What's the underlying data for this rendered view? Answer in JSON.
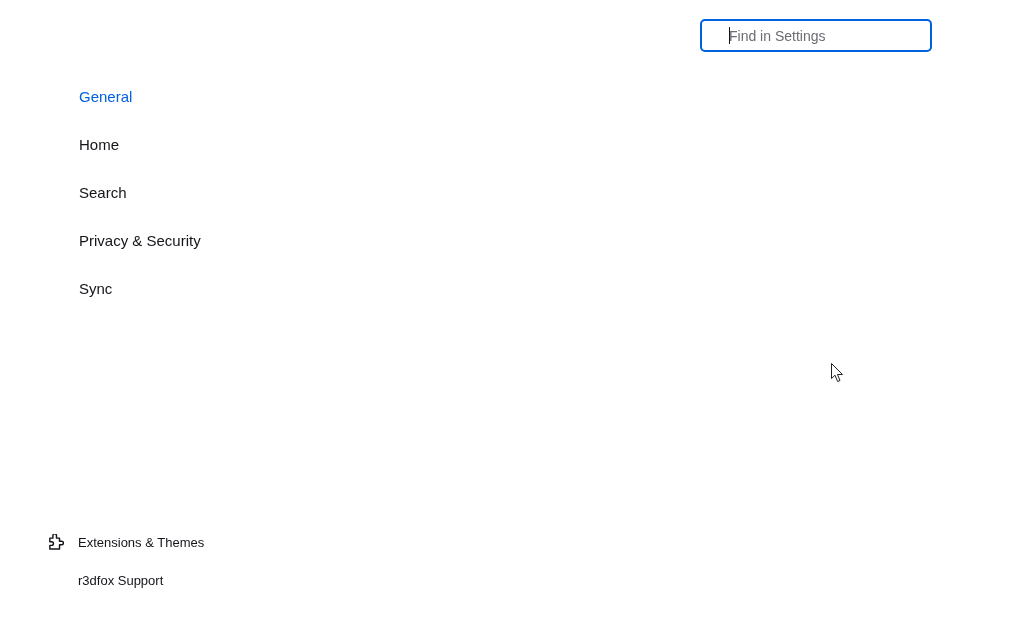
{
  "search": {
    "placeholder": "Find in Settings",
    "focused": true
  },
  "categories": [
    {
      "label": "General",
      "selected": true
    },
    {
      "label": "Home",
      "selected": false
    },
    {
      "label": "Search",
      "selected": false
    },
    {
      "label": "Privacy & Security",
      "selected": false
    },
    {
      "label": "Sync",
      "selected": false
    }
  ],
  "footer_links": [
    {
      "label": "Extensions & Themes",
      "kind": "extensions"
    },
    {
      "label": "r3dfox Support",
      "kind": "support"
    }
  ]
}
